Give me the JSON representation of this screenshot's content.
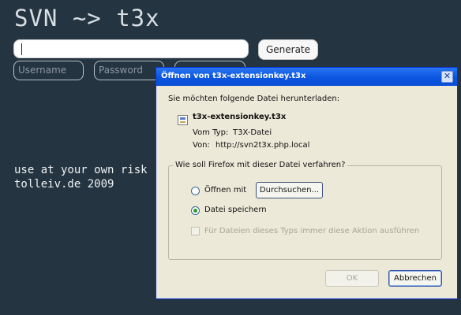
{
  "app": {
    "title": "SVN ~> t3x",
    "url_input": {
      "value": ""
    },
    "generate_label": "Generate",
    "username_placeholder": "Username",
    "password_placeholder": "Password",
    "footer_line1": "use at your own risk",
    "footer_line2": "tolleiv.de 2009"
  },
  "dialog": {
    "title": "Öffnen von t3x-extensionkey.t3x",
    "intro": "Sie möchten folgende Datei herunterladen:",
    "file_name": "t3x-extensionkey.t3x",
    "type_label": "Vom Typ:",
    "type_value": "T3X-Datei",
    "from_label": "Von:",
    "from_value": "http://svn2t3x.php.local",
    "group_title": "Wie soll Firefox mit dieser Datei verfahren?",
    "open_with_label": "Öffnen mit",
    "browse_label": "Durchsuchen...",
    "save_label": "Datei speichern",
    "always_label": "Für Dateien dieses Typs immer diese Aktion ausführen",
    "ok_label": "OK",
    "cancel_label": "Abbrechen",
    "selected_option": "save"
  },
  "colors": {
    "page_bg": "#243440",
    "titlebar": "#0a55e0",
    "dialog_bg": "#ece9d8"
  }
}
